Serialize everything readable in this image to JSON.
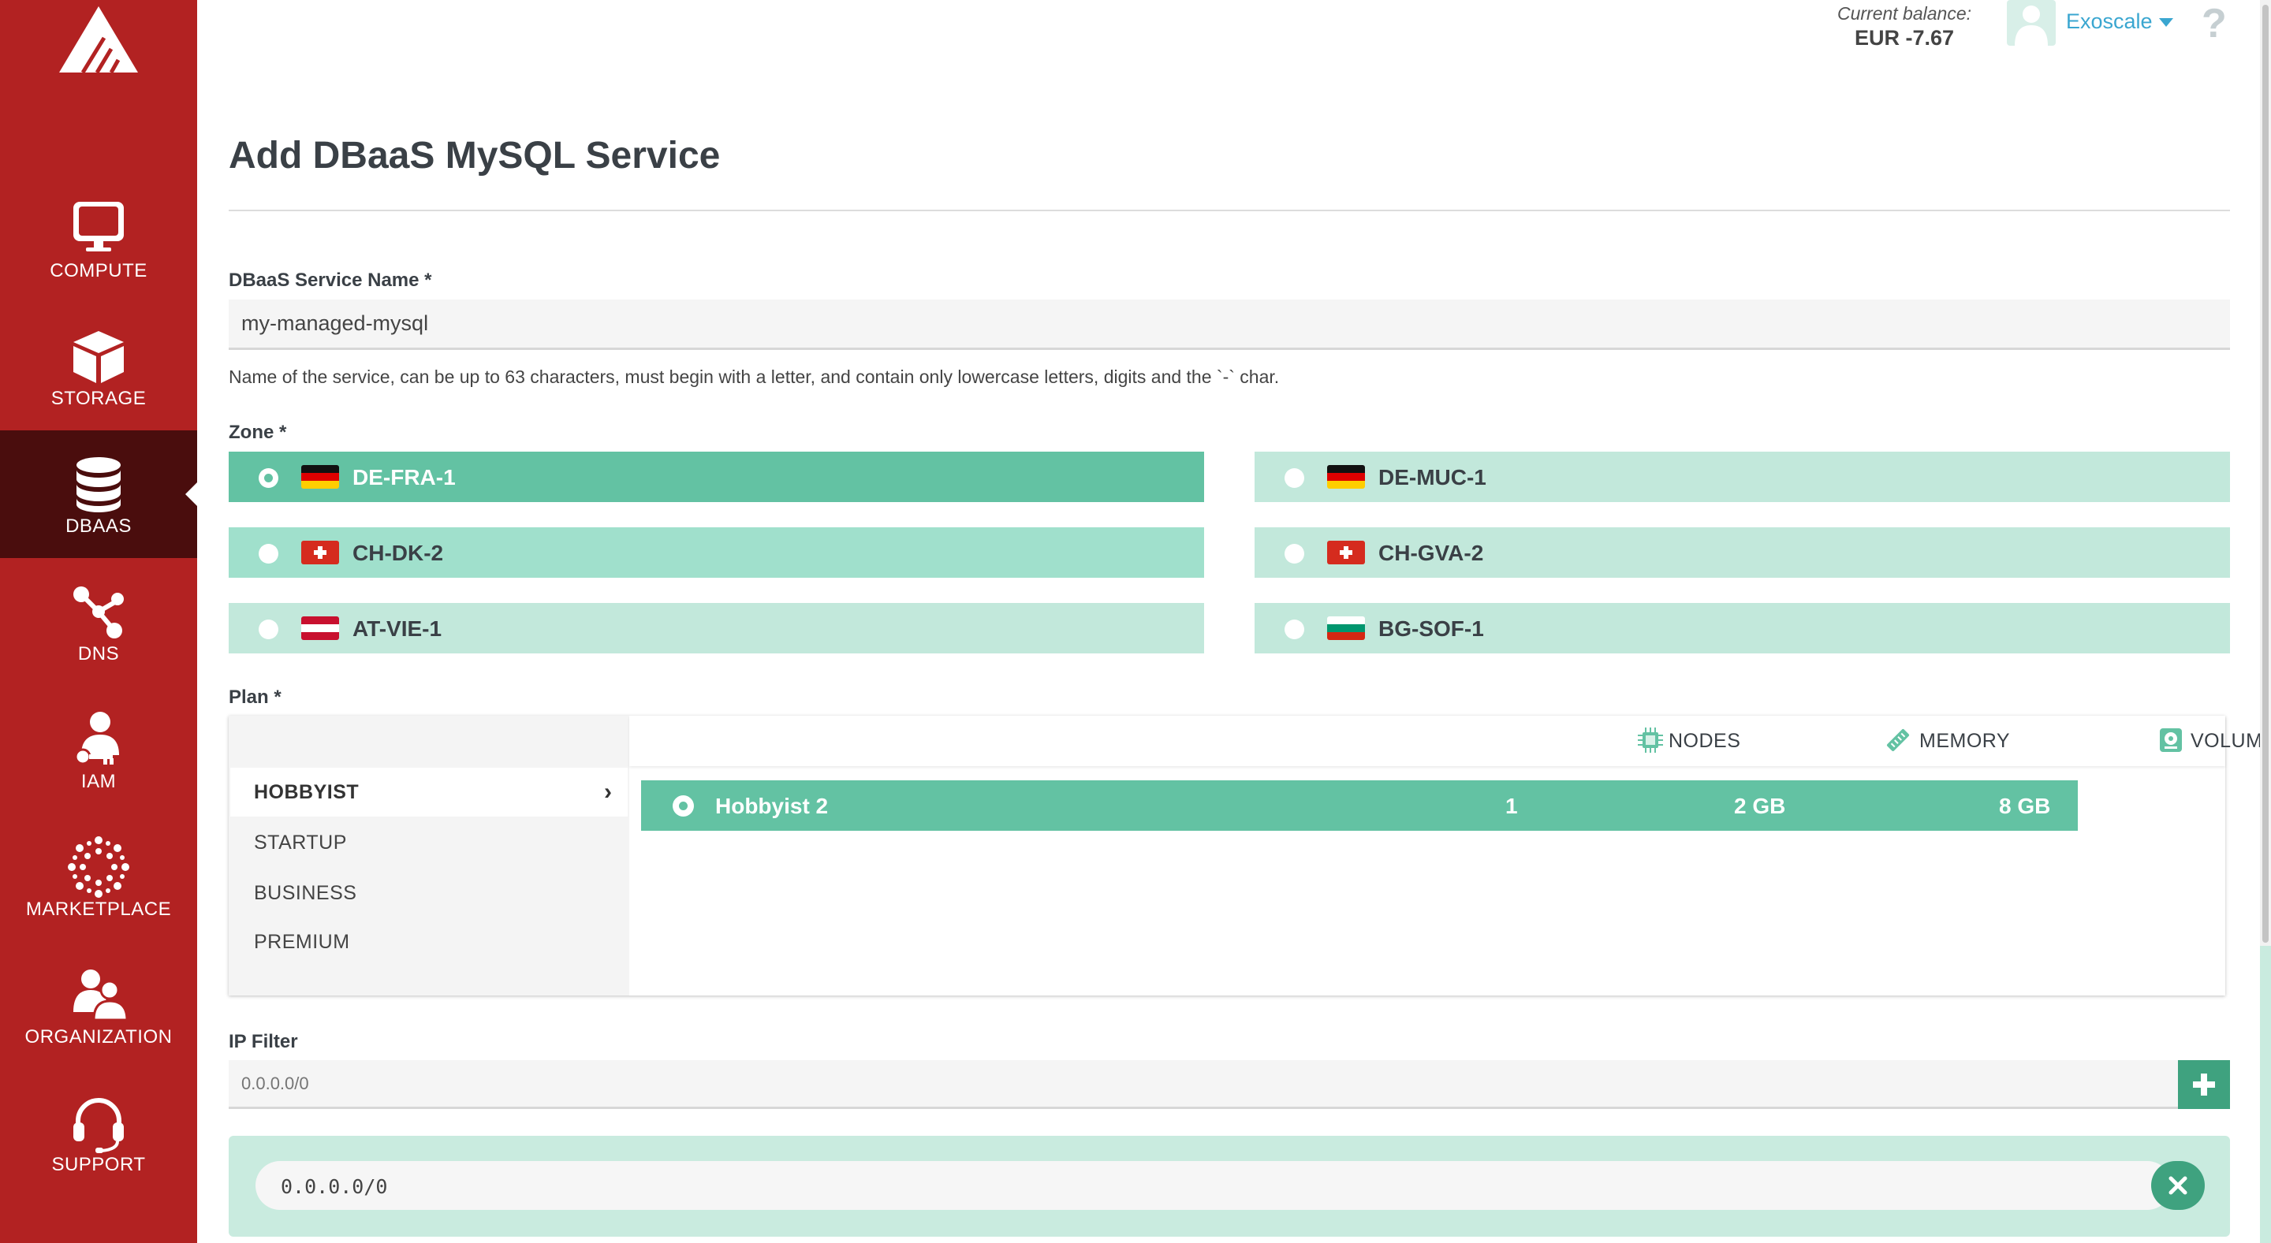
{
  "sidebar": {
    "items": [
      {
        "label": "COMPUTE",
        "icon": "monitor-icon"
      },
      {
        "label": "STORAGE",
        "icon": "cube-icon"
      },
      {
        "label": "DBAAS",
        "icon": "database-icon",
        "active": true
      },
      {
        "label": "DNS",
        "icon": "share-nodes-icon"
      },
      {
        "label": "IAM",
        "icon": "user-key-icon"
      },
      {
        "label": "MARKETPLACE",
        "icon": "dots-circle-icon"
      },
      {
        "label": "ORGANIZATION",
        "icon": "users-icon"
      },
      {
        "label": "SUPPORT",
        "icon": "headset-icon"
      }
    ]
  },
  "header": {
    "balance_label": "Current balance:",
    "balance_value": "EUR -7.67",
    "account_name": "Exoscale",
    "help": "?"
  },
  "page": {
    "title": "Add DBaaS MySQL Service"
  },
  "service_name": {
    "label": "DBaaS Service Name *",
    "value": "my-managed-mysql",
    "help": "Name of the service, can be up to 63 characters, must begin with a letter, and contain only lowercase letters, digits and the `-` char."
  },
  "zone": {
    "label": "Zone *",
    "options": [
      {
        "name": "DE-FRA-1",
        "flag": "de",
        "selected": true
      },
      {
        "name": "DE-MUC-1",
        "flag": "de",
        "selected": false
      },
      {
        "name": "CH-DK-2",
        "flag": "ch",
        "selected": false
      },
      {
        "name": "CH-GVA-2",
        "flag": "ch",
        "selected": false
      },
      {
        "name": "AT-VIE-1",
        "flag": "at",
        "selected": false
      },
      {
        "name": "BG-SOF-1",
        "flag": "bg",
        "selected": false
      }
    ]
  },
  "plan": {
    "label": "Plan *",
    "tabs": [
      "HOBBYIST",
      "STARTUP",
      "BUSINESS",
      "PREMIUM"
    ],
    "active_tab": "HOBBYIST",
    "columns": [
      "NODES",
      "MEMORY",
      "VOLUME"
    ],
    "rows": [
      {
        "name": "Hobbyist 2",
        "nodes": "1",
        "memory": "2 GB",
        "volume": "8 GB",
        "selected": true
      }
    ]
  },
  "ip_filter": {
    "label": "IP Filter",
    "placeholder": "0.0.0.0/0",
    "entries": [
      "0.0.0.0/0"
    ]
  },
  "colors": {
    "sidebar": "#b22222",
    "sidebar_active": "#4a0d0d",
    "accent_green": "#63c2a3",
    "light_green": "#c2e8db",
    "button_green": "#3fa27f",
    "link_blue": "#3aa6d0"
  }
}
